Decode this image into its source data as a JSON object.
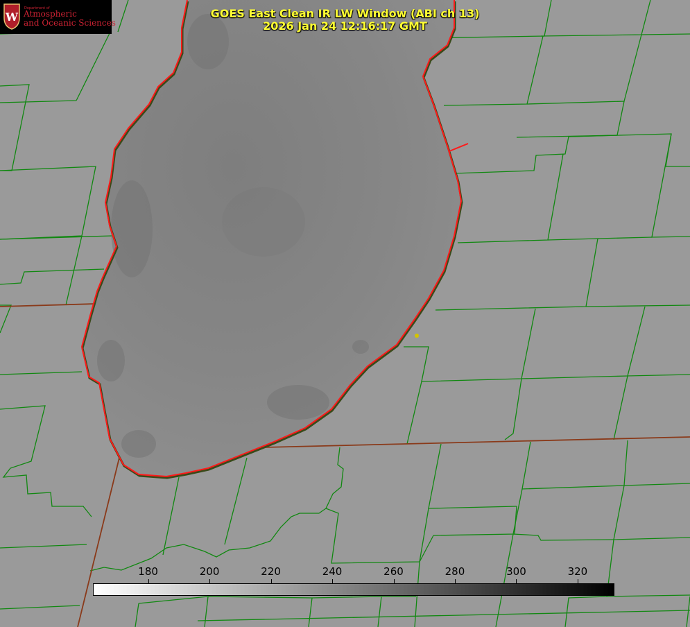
{
  "title": {
    "line1": "GOES East Clean IR LW Window (ABI ch 13)",
    "line2": "2026 Jan 24 12:16:17 GMT"
  },
  "logo": {
    "dept_label": "Department of",
    "line1": "Atmospheric",
    "line2": "and Oceanic Sciences",
    "crest_letter": "W",
    "icon": "uw-crest-icon"
  },
  "colorbar": {
    "ticks": [
      "180",
      "200",
      "220",
      "240",
      "260",
      "280",
      "300",
      "320"
    ],
    "range": [
      162,
      332
    ],
    "gradient": "white-to-black"
  },
  "colors": {
    "title_text": "#ffff33",
    "lake_shoreline": "#ff1a1a",
    "county_borders": "#118811",
    "state_borders": "#8a3a1a",
    "background_gray": "#9a9a9a",
    "lake_gray": "#888888",
    "station_marker": "#d4c400"
  },
  "map": {
    "feature": "lake-shoreline",
    "marker": "station-dot"
  }
}
